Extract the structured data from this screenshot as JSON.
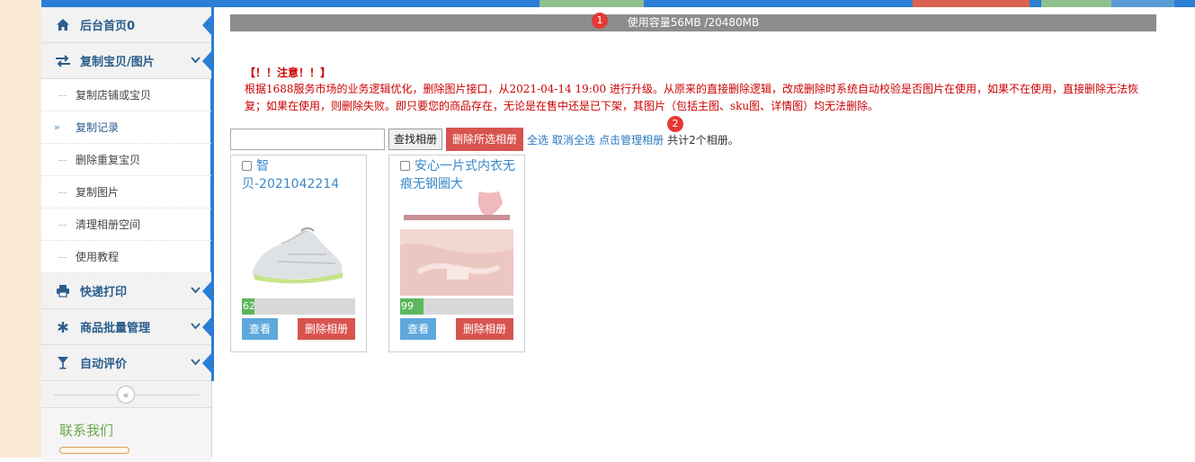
{
  "top_strip": {
    "base_color": "#2b7dd6",
    "segments": [
      "#7fb87f",
      "#d9534f",
      "#7fb87f",
      "#5a9bd4"
    ]
  },
  "sidebar": {
    "home": {
      "label": "后台首页0",
      "icon": "home-icon"
    },
    "copy_section": {
      "label": "复制宝贝/图片",
      "icon": "swap-arrows-icon"
    },
    "sub_items": [
      {
        "label": "复制店铺或宝贝"
      },
      {
        "label": "复制记录",
        "active": true
      },
      {
        "label": "删除重复宝贝"
      },
      {
        "label": "复制图片"
      },
      {
        "label": "清理相册空间"
      },
      {
        "label": "使用教程"
      }
    ],
    "express": {
      "label": "快递打印",
      "icon": "printer-icon"
    },
    "batch": {
      "label": "商品批量管理",
      "icon": "asterisk-icon"
    },
    "review": {
      "label": "自动评价",
      "icon": "glass-icon"
    },
    "contact_title": "联系我们"
  },
  "main": {
    "usage_text": "使用容量56MB /20480MB",
    "badge1": "1",
    "badge2": "2",
    "notice_title": "【！！注意！！】",
    "notice_text": "根据1688服务市场的业务逻辑优化，删除图片接口，从2021-04-14 19:00 进行升级。从原来的直接删除逻辑，改成删除时系统自动校验是否图片在使用，如果不在使用，直接删除无法恢复；如果在使用，则删除失败。即只要您的商品存在，无论是在售中还是已下架，其图片（包括主图、sku图、详情图）均无法删除。",
    "search_placeholder": "",
    "find_button": "查找相册",
    "delete_selected_button": "删除所选相册",
    "select_all": "全选",
    "deselect_all": "取消全选",
    "manage_albums": "点击管理相册",
    "album_count": "共计2个相册。"
  },
  "albums": [
    {
      "title": "智贝-2021042214",
      "count": "62",
      "view": "查看",
      "delete": "删除相册"
    },
    {
      "title": "安心一片式内衣无痕无钢圈大",
      "count": "99",
      "view": "查看",
      "delete": "删除相册"
    }
  ]
}
